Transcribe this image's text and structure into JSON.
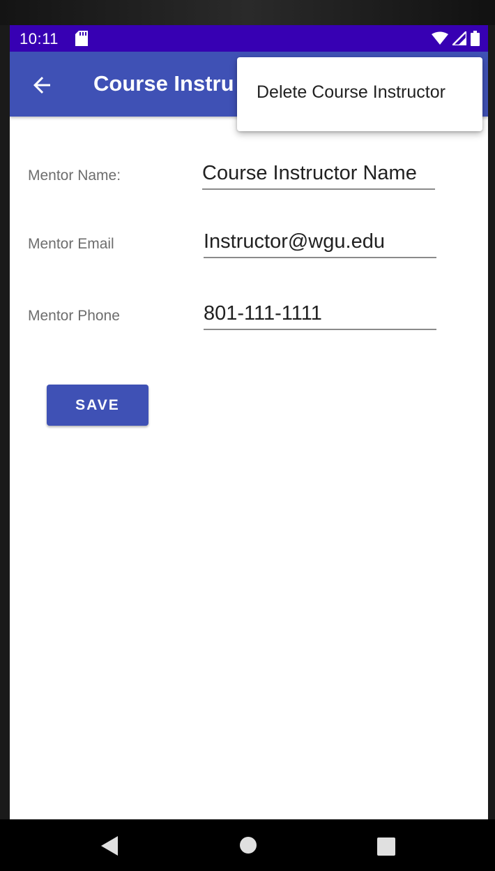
{
  "status_bar": {
    "time": "10:11"
  },
  "app_bar": {
    "title": "Course Instru"
  },
  "overflow_menu": {
    "items": [
      {
        "label": "Delete Course Instructor"
      }
    ]
  },
  "form": {
    "fields": [
      {
        "label": "Mentor Name:",
        "value": "Course Instructor Name"
      },
      {
        "label": "Mentor Email",
        "value": "Instructor@wgu.edu"
      },
      {
        "label": "Mentor Phone",
        "value": "801-111-1111"
      }
    ],
    "save_label": "SAVE"
  },
  "icons": {
    "back": "arrow-left-icon",
    "sd_card": "sd-card-icon",
    "wifi": "wifi-icon",
    "signal": "signal-icon",
    "battery": "battery-icon",
    "nav_back": "triangle-back-icon",
    "nav_home": "circle-home-icon",
    "nav_recents": "square-recents-icon"
  },
  "colors": {
    "status_bar": "#3700b3",
    "app_bar": "#3f51b5",
    "button": "#3f51b5"
  }
}
